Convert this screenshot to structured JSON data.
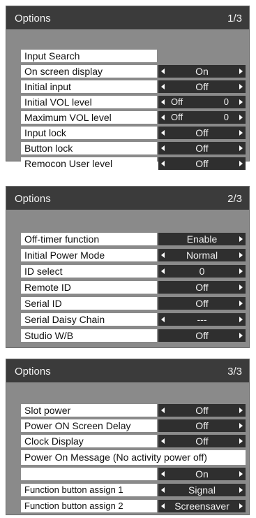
{
  "panel1": {
    "title": "Options",
    "page": "1/3",
    "items": [
      {
        "label": "Input Search",
        "value": null
      },
      {
        "label": "On screen display",
        "value": "On"
      },
      {
        "label": "Initial input",
        "value": "Off"
      },
      {
        "label": "Initial VOL level",
        "value": "Off",
        "value2": "0"
      },
      {
        "label": "Maximum VOL level",
        "value": "Off",
        "value2": "0"
      },
      {
        "label": "Input lock",
        "value": "Off"
      },
      {
        "label": "Button lock",
        "value": "Off"
      },
      {
        "label": "Remocon User level",
        "value": "Off"
      }
    ]
  },
  "panel2": {
    "title": "Options",
    "page": "2/3",
    "items": [
      {
        "label": "Off-timer function",
        "value": "Enable"
      },
      {
        "label": "Initial Power Mode",
        "value": "Normal"
      },
      {
        "label": "ID select",
        "value": "0"
      },
      {
        "label": "Remote ID",
        "value": "Off"
      },
      {
        "label": "Serial ID",
        "value": "Off"
      },
      {
        "label": "Serial Daisy Chain",
        "value": "---"
      },
      {
        "label": "Studio W/B",
        "value": "Off"
      }
    ]
  },
  "panel3": {
    "title": "Options",
    "page": "3/3",
    "items": [
      {
        "label": "Slot power",
        "value": "Off"
      },
      {
        "label": "Power ON Screen Delay",
        "value": "Off"
      },
      {
        "label": "Clock Display",
        "value": "Off"
      }
    ],
    "message_label": "Power On Message (No activity power off)",
    "message_value": "On",
    "function_items": [
      {
        "label": "Function button assign 1",
        "value": "Signal"
      },
      {
        "label": "Function button assign 2",
        "value": "Screensaver"
      }
    ]
  }
}
